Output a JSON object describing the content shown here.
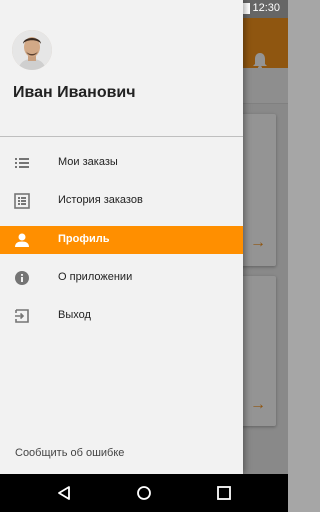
{
  "status_bar": {
    "time": "12:30"
  },
  "background": {
    "subbar_text": ")"
  },
  "drawer": {
    "user_name": "Иван Иванович",
    "menu": [
      {
        "label": "Мои заказы",
        "icon": "list-icon",
        "active": false
      },
      {
        "label": "История заказов",
        "icon": "history-list-icon",
        "active": false
      },
      {
        "label": "Профиль",
        "icon": "person-icon",
        "active": true
      },
      {
        "label": "О приложении",
        "icon": "info-icon",
        "active": false
      },
      {
        "label": "Выход",
        "icon": "exit-icon",
        "active": false
      }
    ],
    "report_link": "Сообщить об ошибке"
  },
  "colors": {
    "accent": "#ff8f00",
    "toolbar": "#f7941d"
  }
}
